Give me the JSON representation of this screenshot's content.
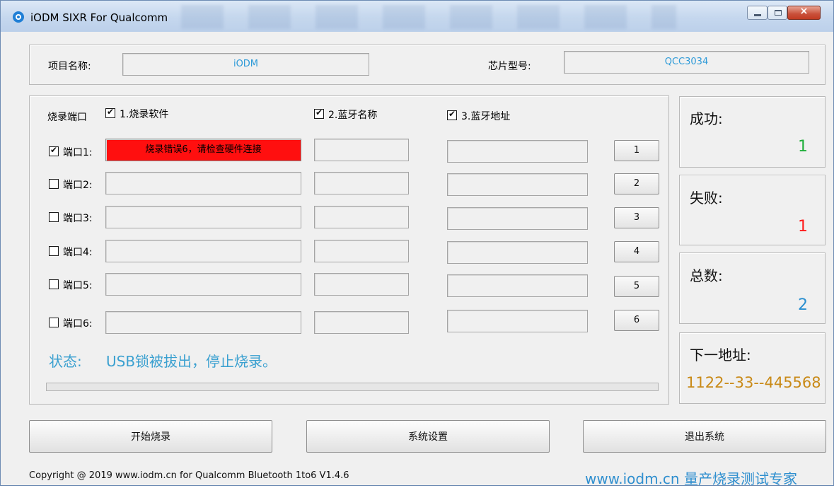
{
  "window": {
    "title": "iODM SIXR For Qualcomm",
    "close_glyph": "×"
  },
  "project": {
    "name_label": "项目名称:",
    "name_value": "iODM",
    "chip_label": "芯片型号:",
    "chip_value": "QCC3034"
  },
  "ports": {
    "header_label": "烧录端口",
    "options": [
      {
        "label": "1.烧录软件",
        "checked": true
      },
      {
        "label": "2.蓝牙名称",
        "checked": true
      },
      {
        "label": "3.蓝牙地址",
        "checked": true
      }
    ],
    "rows": [
      {
        "label": "端口1:",
        "checked": true,
        "software": "烧录错误6，请检查硬件连接",
        "error": true,
        "button": "1"
      },
      {
        "label": "端口2:",
        "checked": false,
        "software": "",
        "error": false,
        "button": "2"
      },
      {
        "label": "端口3:",
        "checked": false,
        "software": "",
        "error": false,
        "button": "3"
      },
      {
        "label": "端口4:",
        "checked": false,
        "software": "",
        "error": false,
        "button": "4"
      },
      {
        "label": "端口5:",
        "checked": false,
        "software": "",
        "error": false,
        "button": "5"
      },
      {
        "label": "端口6:",
        "checked": false,
        "software": "",
        "error": false,
        "button": "6"
      }
    ],
    "error_color": "#ff0f0f"
  },
  "status": {
    "label": "状态:",
    "text": "USB锁被拔出，停止烧录。",
    "progress_percent": 0,
    "color": "#3aa0d0"
  },
  "stats": {
    "success": {
      "label": "成功:",
      "value": "1",
      "color": "#1fae3a"
    },
    "failure": {
      "label": "失败:",
      "value": "1",
      "color": "#ff1a1a"
    },
    "total": {
      "label": "总数:",
      "value": "2",
      "color": "#2a8fd0"
    },
    "next_address": {
      "label": "下一地址:",
      "value": "1122--33--445568",
      "color": "#c98a17"
    }
  },
  "actions": {
    "start": "开始烧录",
    "settings": "系统设置",
    "exit": "退出系统"
  },
  "footer": {
    "copyright": "Copyright @ 2019 www.iodm.cn for Qualcomm Bluetooth 1to6 V1.4.6",
    "slogan": "www.iodm.cn 量产烧录测试专家"
  }
}
